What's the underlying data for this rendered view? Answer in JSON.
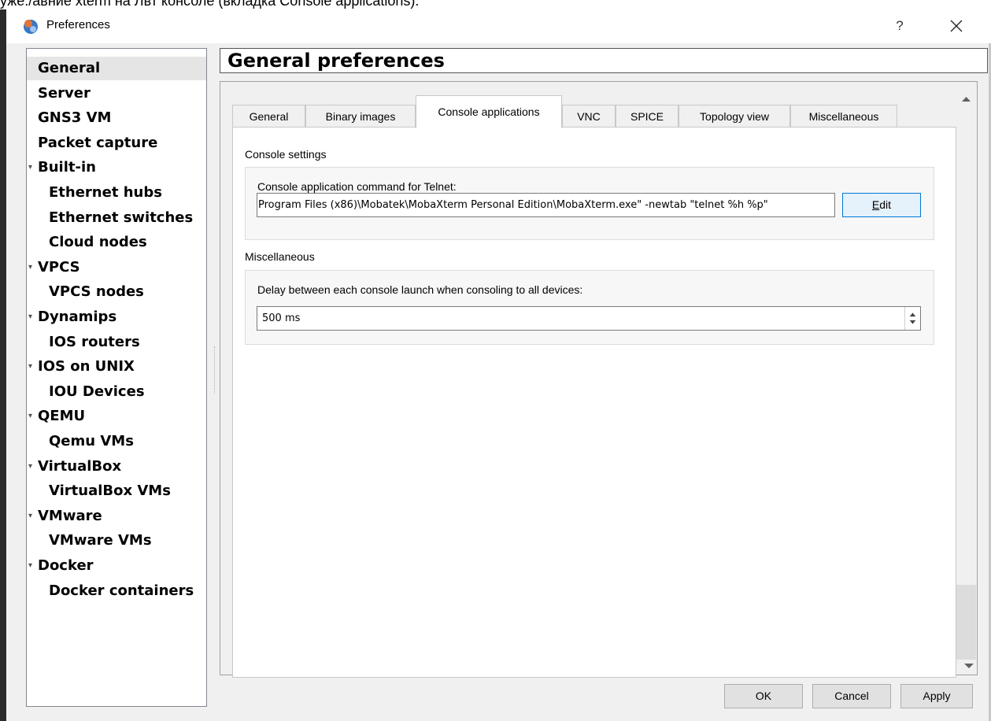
{
  "top_strip_text": "уже./авние xterm на Лвт консоле (вкладка Console applications).",
  "window": {
    "title": "Preferences",
    "help_label": "?"
  },
  "nav": {
    "items": [
      {
        "label": "General",
        "level": 0,
        "expandable": false,
        "selected": true
      },
      {
        "label": "Server",
        "level": 0,
        "expandable": false
      },
      {
        "label": "GNS3 VM",
        "level": 0,
        "expandable": false
      },
      {
        "label": "Packet capture",
        "level": 0,
        "expandable": false
      },
      {
        "label": "Built-in",
        "level": 0,
        "expandable": true
      },
      {
        "label": "Ethernet hubs",
        "level": 1,
        "expandable": false
      },
      {
        "label": "Ethernet switches",
        "level": 1,
        "expandable": false
      },
      {
        "label": "Cloud nodes",
        "level": 1,
        "expandable": false
      },
      {
        "label": "VPCS",
        "level": 0,
        "expandable": true
      },
      {
        "label": "VPCS nodes",
        "level": 1,
        "expandable": false
      },
      {
        "label": "Dynamips",
        "level": 0,
        "expandable": true
      },
      {
        "label": "IOS routers",
        "level": 1,
        "expandable": false
      },
      {
        "label": "IOS on UNIX",
        "level": 0,
        "expandable": true
      },
      {
        "label": "IOU Devices",
        "level": 1,
        "expandable": false
      },
      {
        "label": "QEMU",
        "level": 0,
        "expandable": true
      },
      {
        "label": "Qemu VMs",
        "level": 1,
        "expandable": false
      },
      {
        "label": "VirtualBox",
        "level": 0,
        "expandable": true
      },
      {
        "label": "VirtualBox VMs",
        "level": 1,
        "expandable": false
      },
      {
        "label": "VMware",
        "level": 0,
        "expandable": true
      },
      {
        "label": "VMware VMs",
        "level": 1,
        "expandable": false
      },
      {
        "label": "Docker",
        "level": 0,
        "expandable": true
      },
      {
        "label": "Docker containers",
        "level": 1,
        "expandable": false
      }
    ]
  },
  "page": {
    "title": "General preferences"
  },
  "tabs": [
    {
      "label": "General",
      "active": false
    },
    {
      "label": "Binary images",
      "active": false
    },
    {
      "label": "Console applications",
      "active": true
    },
    {
      "label": "VNC",
      "active": false
    },
    {
      "label": "SPICE",
      "active": false
    },
    {
      "label": "Topology view",
      "active": false
    },
    {
      "label": "Miscellaneous",
      "active": false
    }
  ],
  "console_settings": {
    "group_label": "Console settings",
    "telnet_label": "Console application command for Telnet:",
    "telnet_value": "Program Files (x86)\\Mobatek\\MobaXterm Personal Edition\\MobaXterm.exe\" -newtab \"telnet %h %p\"",
    "edit_button_mnemonic": "E",
    "edit_button_rest": "dit"
  },
  "miscellaneous": {
    "group_label": "Miscellaneous",
    "delay_label": "Delay between each console launch when consoling to all devices:",
    "delay_value": "500 ms"
  },
  "buttons": {
    "ok": "OK",
    "cancel": "Cancel",
    "apply": "Apply"
  }
}
